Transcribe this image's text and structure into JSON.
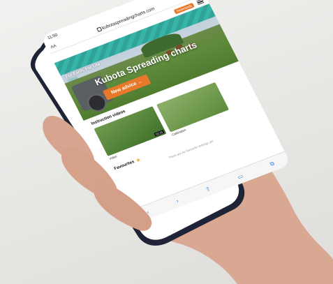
{
  "status_bar": {
    "time": "11:50"
  },
  "browser": {
    "aa_label": "AA",
    "url": "kubotaspreadingcharts.com"
  },
  "site": {
    "language_button": "Nederlands",
    "brand_title": "For Earth, For Life",
    "brand_subtitle": "Kubota",
    "hero_title": "Kubota Spreading charts",
    "advice_button": "New advice →"
  },
  "videos": {
    "title": "Instruction videos",
    "items": [
      {
        "caption": "Video",
        "duration": "01:15"
      },
      {
        "caption": "Calibration"
      }
    ]
  },
  "favourites": {
    "title": "Favourites",
    "empty_text": "There are no favourite settings yet"
  },
  "toolbar": {
    "icons": [
      "back-icon",
      "forward-icon",
      "share-icon",
      "bookmarks-icon",
      "tabs-icon"
    ]
  },
  "colors": {
    "accent": "#e8782a",
    "teal": "#2bb3a5",
    "link": "#2a7fd4"
  }
}
